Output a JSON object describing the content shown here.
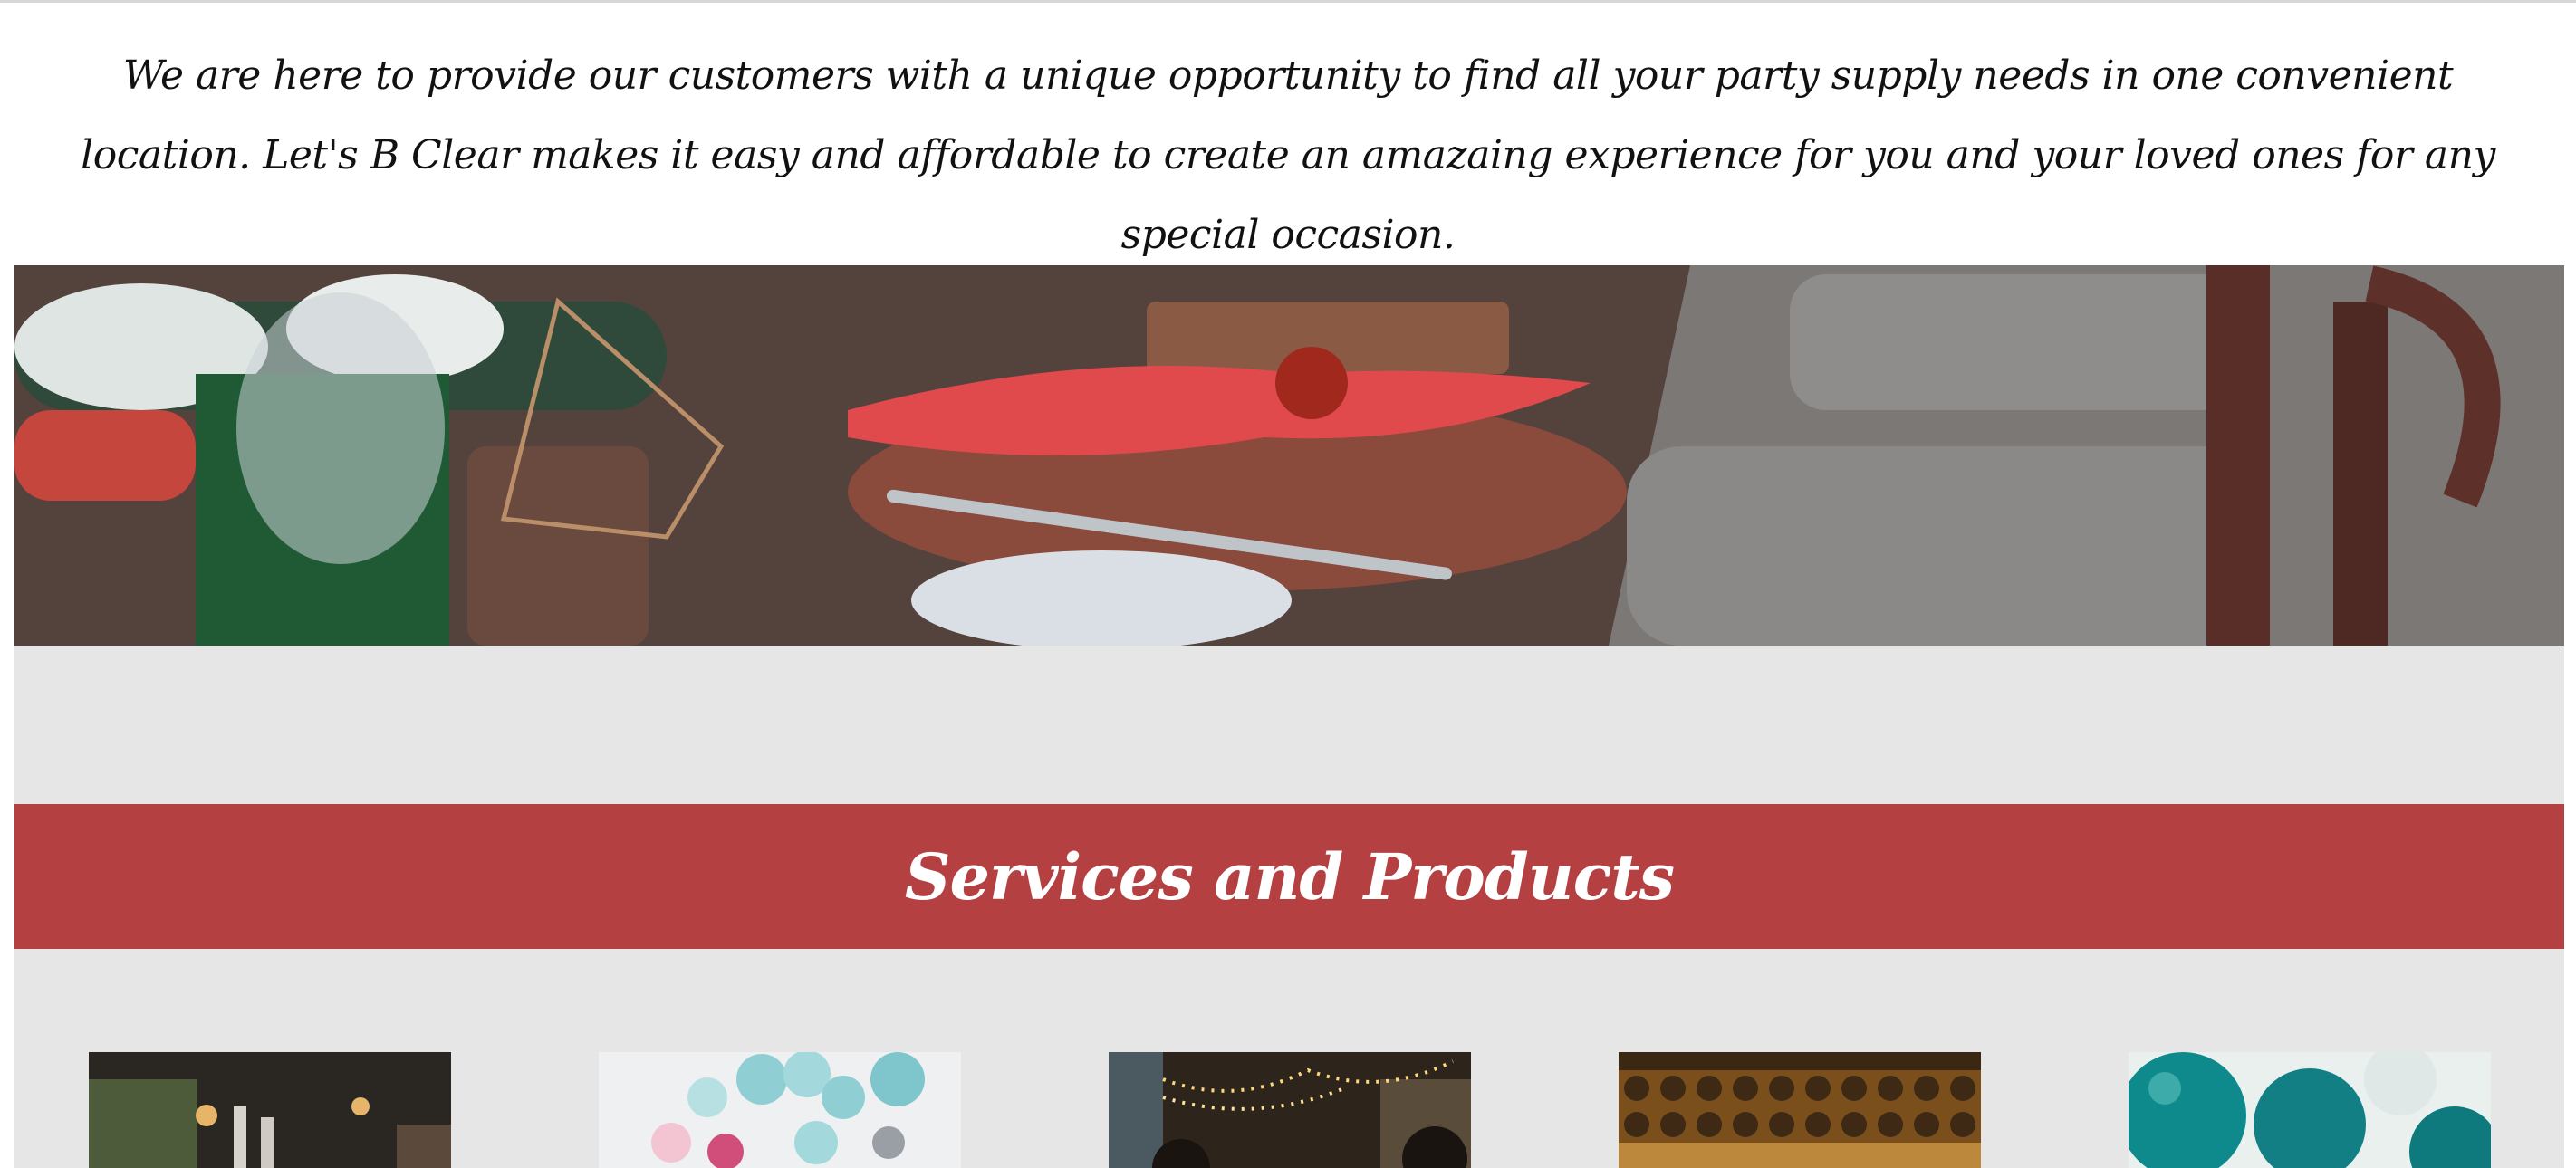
{
  "intro": {
    "text": "We are here to provide our customers with a unique opportunity to find all your party supply needs in one convenient location. Let's B Clear makes it easy and affordable to create an amazaing experience for you and your loved ones for any special occasion."
  },
  "hero": {
    "image": "table-setting-photo"
  },
  "services": {
    "title": "Services and Products"
  },
  "thumbnails": [
    {
      "image": "event-venue-photo"
    },
    {
      "image": "balloon-arch-photo"
    },
    {
      "image": "string-lights-hall-photo"
    },
    {
      "image": "glassware-rack-photo"
    },
    {
      "image": "teal-balloons-photo"
    }
  ],
  "colors": {
    "banner": "#b54042",
    "band": "#e6e6e6",
    "text": "#111111"
  }
}
